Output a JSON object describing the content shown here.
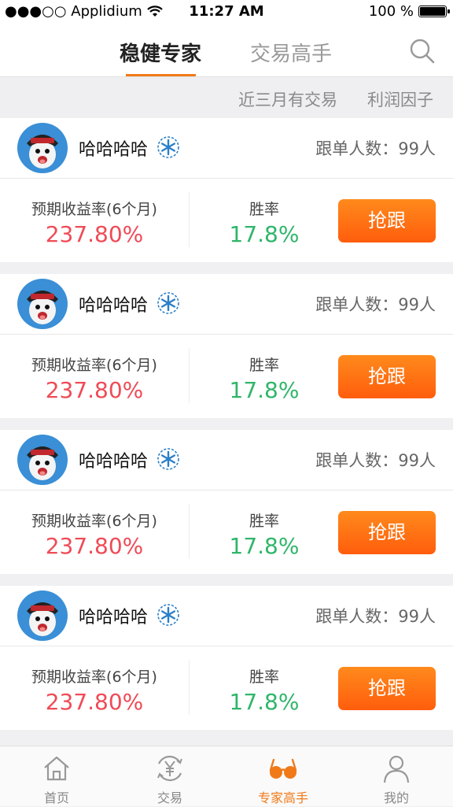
{
  "status_bar": {
    "carrier": "●●●○○ Applidium",
    "time": "11:27 AM",
    "battery": "100 %"
  },
  "top_tabs": [
    {
      "label": "稳健专家",
      "active": true
    },
    {
      "label": "交易高手",
      "active": false
    }
  ],
  "filters": [
    "近三月有交易",
    "利润因子"
  ],
  "cards": [
    {
      "name": "哈哈哈哈",
      "followers": "跟单人数：99人",
      "return_label": "预期收益率(6个月)",
      "return_value": "237.80%",
      "winrate_label": "胜率",
      "winrate_value": "17.8%",
      "button": "抢跟"
    },
    {
      "name": "哈哈哈哈",
      "followers": "跟单人数：99人",
      "return_label": "预期收益率(6个月)",
      "return_value": "237.80%",
      "winrate_label": "胜率",
      "winrate_value": "17.8%",
      "button": "抢跟"
    },
    {
      "name": "哈哈哈哈",
      "followers": "跟单人数：99人",
      "return_label": "预期收益率(6个月)",
      "return_value": "237.80%",
      "winrate_label": "胜率",
      "winrate_value": "17.8%",
      "button": "抢跟"
    },
    {
      "name": "哈哈哈哈",
      "followers": "跟单人数：99人",
      "return_label": "预期收益率(6个月)",
      "return_value": "237.80%",
      "winrate_label": "胜率",
      "winrate_value": "17.8%",
      "button": "抢跟"
    }
  ],
  "bottom_nav": [
    {
      "label": "首页",
      "icon": "home-icon",
      "active": false
    },
    {
      "label": "交易",
      "icon": "yen-exchange-icon",
      "active": false
    },
    {
      "label": "专家高手",
      "icon": "glasses-icon",
      "active": true
    },
    {
      "label": "我的",
      "icon": "person-icon",
      "active": false
    }
  ],
  "colors": {
    "accent": "#f07a18",
    "return_red": "#ef4b57",
    "winrate_green": "#2fb66a",
    "button_orange": "#ff6a10"
  }
}
